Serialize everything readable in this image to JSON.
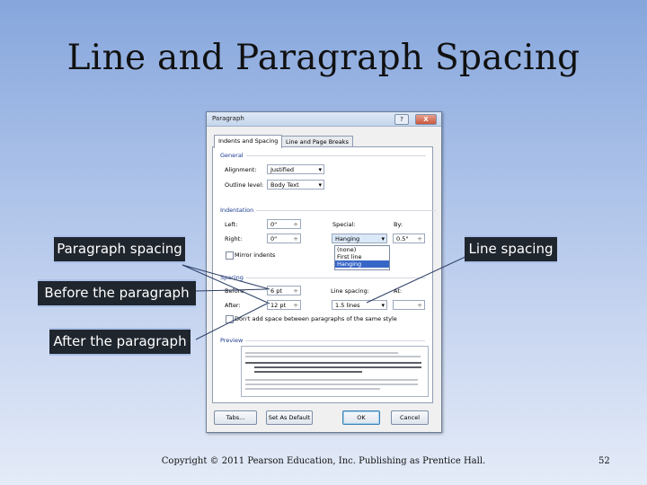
{
  "slide": {
    "title": "Line and Paragraph Spacing",
    "footer": "Copyright © 2011 Pearson Education, Inc. Publishing as Prentice Hall.",
    "page_number": "52"
  },
  "dialog": {
    "title": "Paragraph",
    "help_label": "?",
    "close_label": "X",
    "tabs": [
      "Indents and Spacing",
      "Line and Page Breaks"
    ],
    "general": {
      "heading": "General",
      "alignment_label": "Alignment:",
      "alignment_value": "Justified",
      "outline_label": "Outline level:",
      "outline_value": "Body Text"
    },
    "indentation": {
      "heading": "Indentation",
      "left_label": "Left:",
      "left_value": "0\"",
      "right_label": "Right:",
      "right_value": "0\"",
      "special_label": "Special:",
      "special_value": "Hanging",
      "by_label": "By:",
      "by_value": "0.5\"",
      "mirror_label": "Mirror indents",
      "special_options": [
        "(none)",
        "First line",
        "Hanging"
      ]
    },
    "spacing": {
      "heading": "Spacing",
      "before_label": "Before:",
      "before_value": "6 pt",
      "after_label": "After:",
      "after_value": "12 pt",
      "line_spacing_label": "Line spacing:",
      "line_spacing_value": "1.5 lines",
      "at_label": "At:",
      "dont_add_label": "Don't add space between paragraphs of the same style"
    },
    "preview_heading": "Preview",
    "buttons": {
      "tabs": "Tabs...",
      "set_default": "Set As Default",
      "ok": "OK",
      "cancel": "Cancel"
    }
  },
  "callouts": {
    "paragraph_spacing": "Paragraph spacing",
    "line_spacing": "Line spacing",
    "before": "Before the paragraph",
    "after": "After the paragraph"
  },
  "colors": {
    "callout_bg": "#20262e",
    "callout_text": "#ffffff",
    "leader_line": "#2c3e66",
    "dropdown_selected": "#3766c6"
  }
}
